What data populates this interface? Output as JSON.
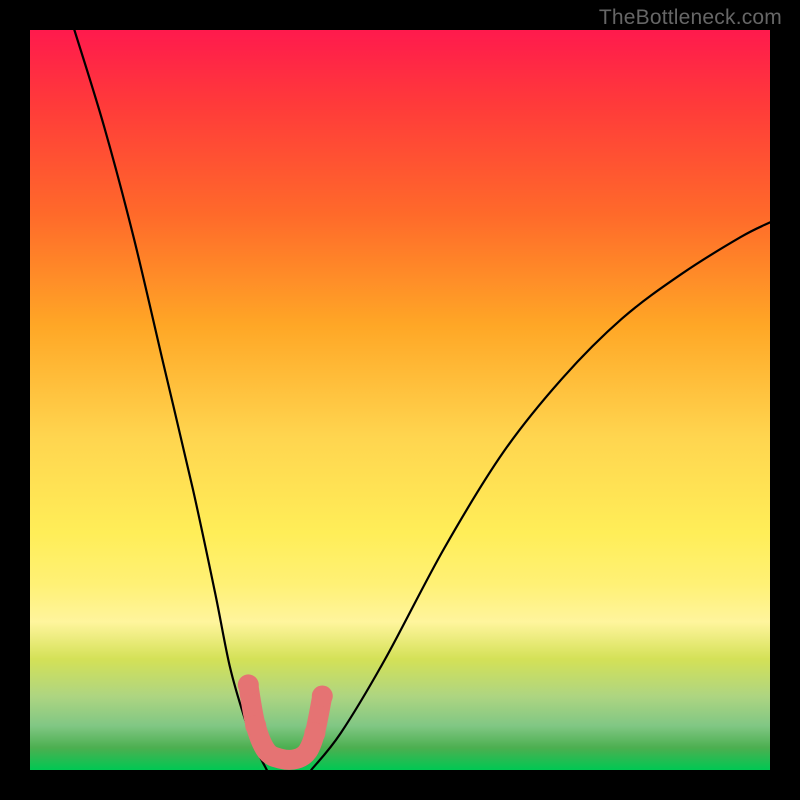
{
  "attribution": "TheBottleneck.com",
  "colors": {
    "background": "#000000",
    "curve": "#000000",
    "worm": "#e57373",
    "gradient_top": "#ff1a4d",
    "gradient_bottom": "#00c853"
  },
  "chart_data": {
    "type": "line",
    "title": "",
    "xlabel": "",
    "ylabel": "",
    "xlim": [
      0,
      100
    ],
    "ylim": [
      0,
      100
    ],
    "series": [
      {
        "name": "left-curve",
        "x": [
          6,
          10,
          14,
          18,
          22,
          25,
          27,
          29,
          30.5,
          32
        ],
        "values": [
          100,
          87,
          72,
          55,
          38,
          24,
          14,
          7,
          3,
          0
        ]
      },
      {
        "name": "right-curve",
        "x": [
          38,
          42,
          48,
          56,
          64,
          72,
          80,
          88,
          96,
          100
        ],
        "values": [
          0,
          5,
          15,
          30,
          43,
          53,
          61,
          67,
          72,
          74
        ]
      },
      {
        "name": "worm-segment",
        "x": [
          29.5,
          30.5,
          32,
          34,
          36,
          37.5,
          38.5,
          39.5
        ],
        "values": [
          11.5,
          6,
          2.5,
          1.5,
          1.5,
          2.5,
          5,
          10
        ]
      }
    ],
    "annotations": []
  }
}
